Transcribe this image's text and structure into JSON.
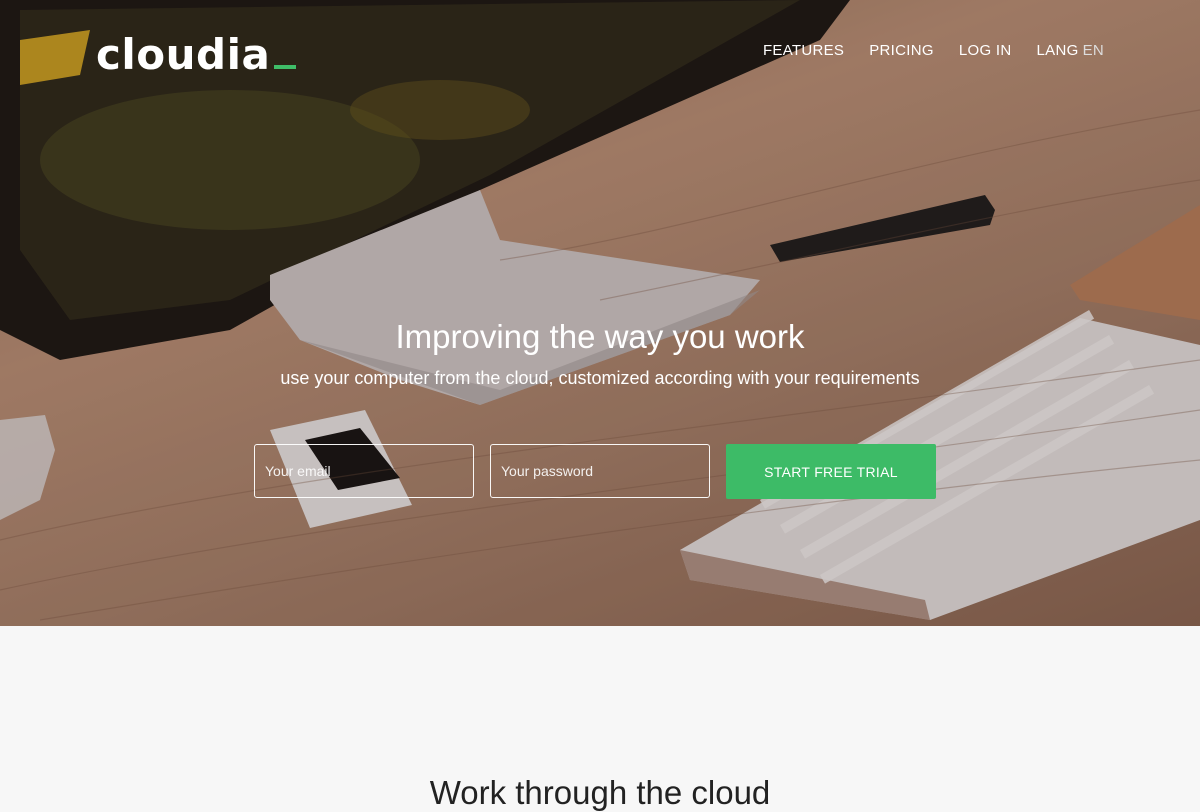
{
  "brand": {
    "name": "cloudia",
    "accent_color": "#3dbb67"
  },
  "nav": {
    "items": [
      "FEATURES",
      "PRICING",
      "LOG IN"
    ],
    "lang_label": "LANG",
    "lang_value": "EN"
  },
  "hero": {
    "headline": "Improving the way you work",
    "subheadline": "use your computer from the cloud, customized according with your requirements",
    "email_placeholder": "Your email",
    "password_placeholder": "Your password",
    "cta_label": "START FREE TRIAL"
  },
  "section": {
    "title": "Work through the cloud"
  }
}
